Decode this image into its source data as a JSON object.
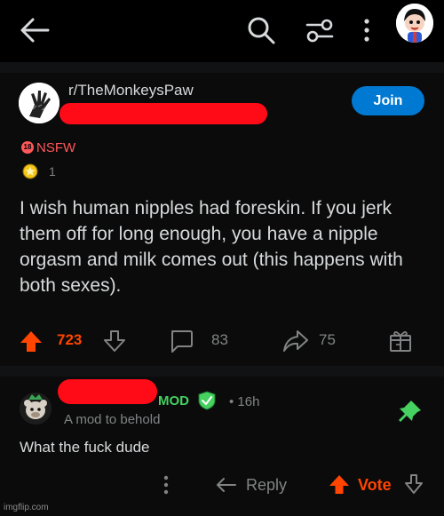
{
  "colors": {
    "background": "#000000",
    "card": "#0b0b0b",
    "text": "#d7dadc",
    "muted": "#818384",
    "upvote": "#ff4500",
    "join": "#0079d3",
    "nsfw": "#ff585b",
    "mod": "#46d160",
    "redaction": "#ff0a17"
  },
  "topbar": {
    "icons": [
      "back-arrow-icon",
      "search-icon",
      "filter-icon",
      "more-vertical-icon",
      "avatar"
    ]
  },
  "post": {
    "subreddit": "r/TheMonkeysPaw",
    "join_label": "Join",
    "nsfw_badge": "18",
    "nsfw_label": "NSFW",
    "award_count": "1",
    "title": "I wish human nipples had foreskin. If you jerk them off for long enough, you have a nipple orgasm and milk comes out (this happens with both sexes).",
    "score": "723",
    "comments": "83",
    "shares": "75"
  },
  "comment": {
    "mod_label": "MOD",
    "time": "• 16h",
    "flair": "A mod to behold",
    "body": "What the fuck dude",
    "reply_label": "Reply",
    "vote_label": "Vote"
  },
  "watermark": "imgflip.com"
}
